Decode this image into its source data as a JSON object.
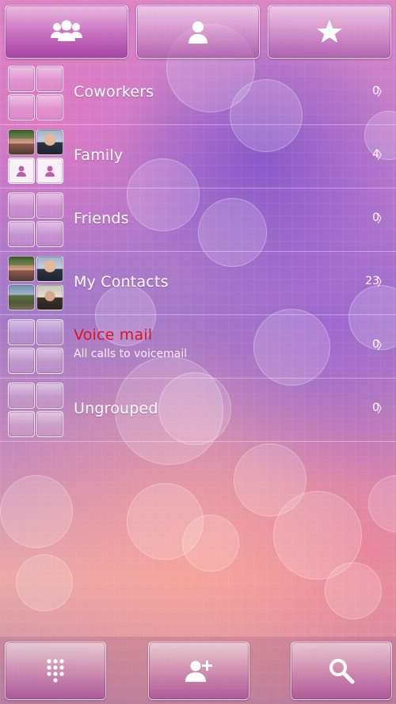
{
  "top_tabs": [
    {
      "name": "groups",
      "icon": "group-icon",
      "active": true
    },
    {
      "name": "contacts",
      "icon": "person-icon",
      "active": false
    },
    {
      "name": "favorites",
      "icon": "star-icon",
      "active": false
    }
  ],
  "groups": [
    {
      "name": "Coworkers",
      "count": "0",
      "subtitle": ""
    },
    {
      "name": "Family",
      "count": "4",
      "subtitle": ""
    },
    {
      "name": "Friends",
      "count": "0",
      "subtitle": ""
    },
    {
      "name": "My Contacts",
      "count": "23",
      "subtitle": ""
    },
    {
      "name": "Voice mail",
      "count": "0",
      "subtitle": "All calls to voicemail"
    },
    {
      "name": "Ungrouped",
      "count": "0",
      "subtitle": ""
    }
  ],
  "chevron": "〉",
  "bottom_bar": [
    {
      "name": "dialpad",
      "icon": "dialpad-icon"
    },
    {
      "name": "add-contact",
      "icon": "add-person-icon"
    },
    {
      "name": "search",
      "icon": "search-icon"
    }
  ],
  "colors": {
    "voicemail_label": "#e0131c",
    "text": "#ffffff"
  }
}
